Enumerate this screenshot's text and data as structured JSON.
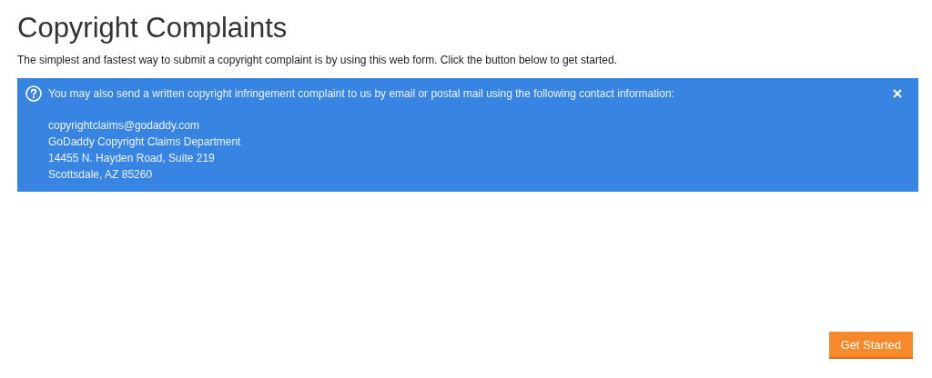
{
  "title": "Copyright Complaints",
  "intro": "The simplest and fastest way to submit a copyright complaint is by using this web form. Click the button below to get started.",
  "notice": {
    "message": "You may also send a written copyright infringement complaint to us by email or postal mail using the following contact information:",
    "contact_lines": [
      "copyrightclaims@godaddy.com",
      "GoDaddy Copyright Claims Department",
      "14455 N. Hayden Road, Suite 219",
      "Scottsdale, AZ 85260"
    ]
  },
  "buttons": [
    "Get Started"
  ]
}
